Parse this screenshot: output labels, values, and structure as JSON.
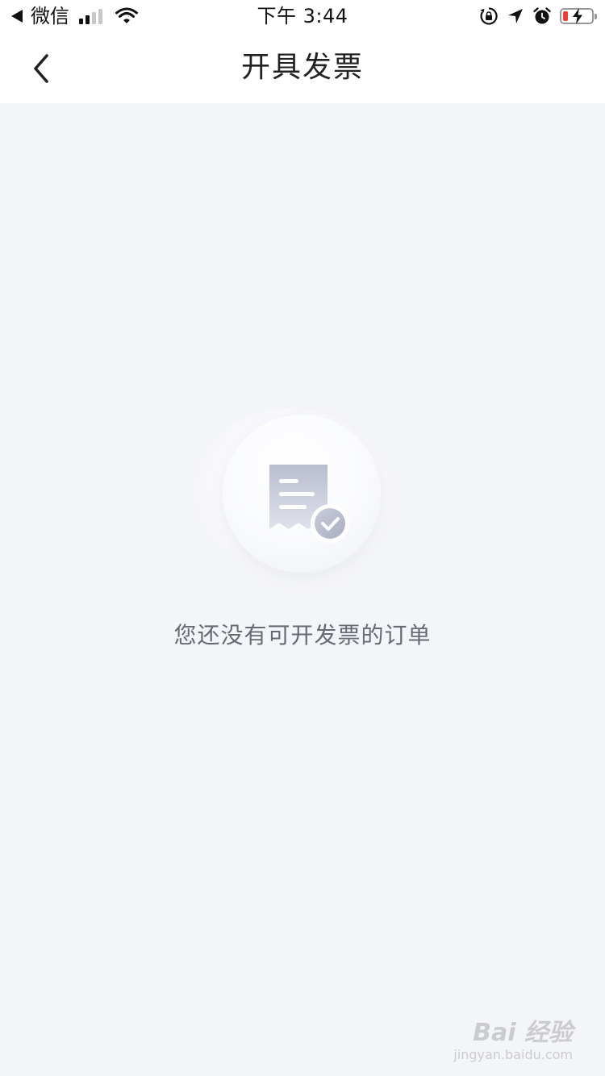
{
  "status_bar": {
    "carrier": "微信",
    "time": "下午 3:44",
    "icons": {
      "back_app": "back-triangle-icon",
      "signal": "signal-bars-icon",
      "wifi": "wifi-icon",
      "rotation_lock": "rotation-lock-icon",
      "location": "location-arrow-icon",
      "alarm": "alarm-icon",
      "battery": "battery-charging-icon"
    },
    "battery_color": "#e8413c"
  },
  "nav": {
    "title": "开具发票",
    "back_icon": "chevron-left-icon"
  },
  "empty_state": {
    "icon": "receipt-check-icon",
    "message": "您还没有可开发票的订单"
  },
  "watermark": {
    "logo": "Bai 经验",
    "url": "jingyan.baidu.com"
  },
  "colors": {
    "background": "#f4f5f9",
    "bar": "#ffffff",
    "icon_gradient_top": "#b9bdd0",
    "icon_gradient_bottom": "#dfe1ea"
  }
}
